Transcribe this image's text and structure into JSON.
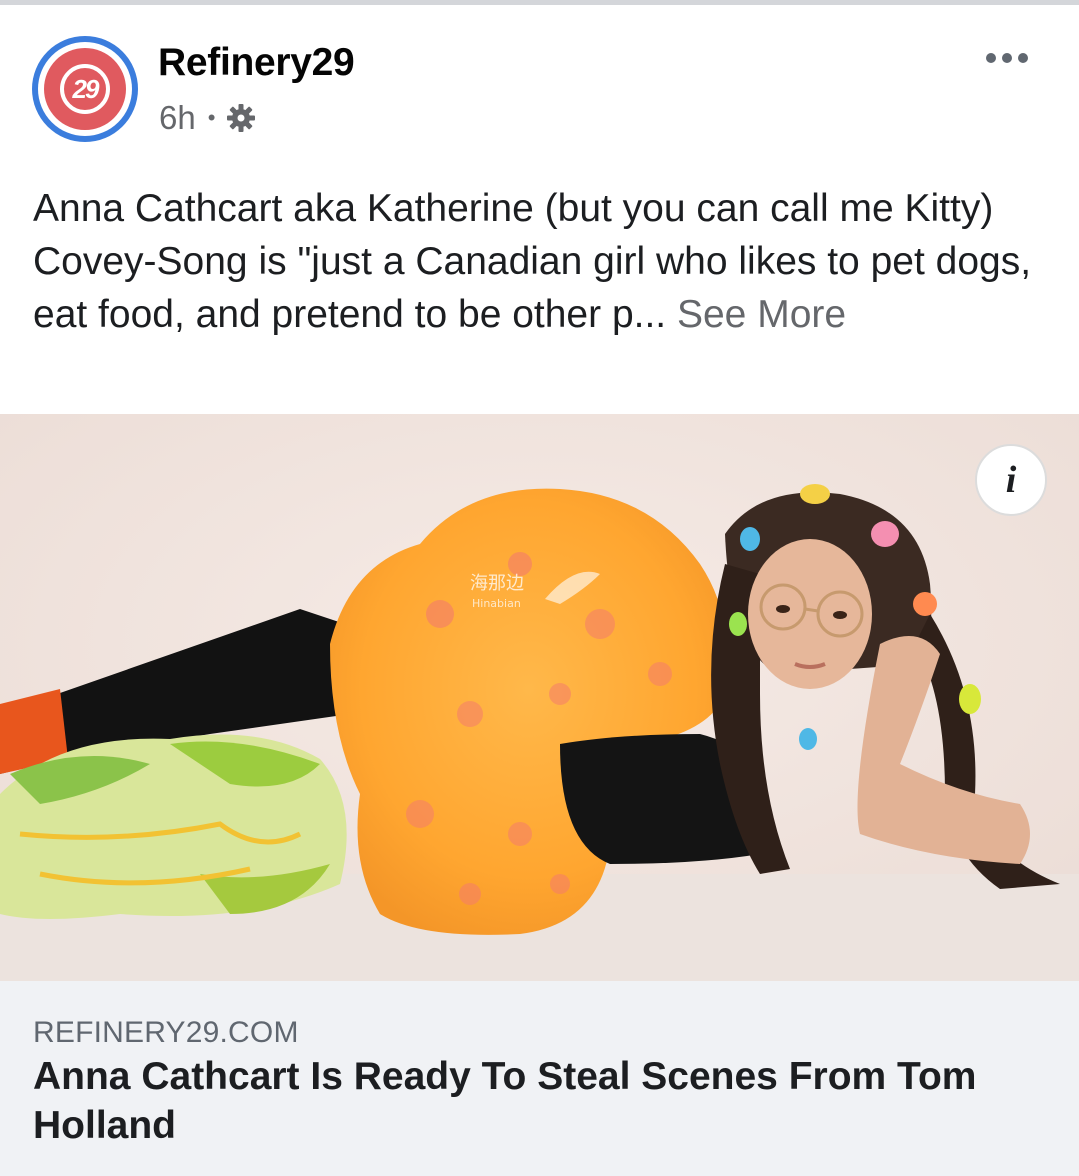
{
  "post": {
    "page_name": "Refinery29",
    "time": "6h",
    "separator": "•",
    "avatar_text": "29",
    "caption": "Anna Cathcart aka Katherine (but you can call me Kitty) Covey-Song is \"just a Canadian girl who likes to pet dogs, eat food, and pretend to be other p...",
    "see_more": "See More",
    "icons": {
      "privacy": "gear-icon",
      "menu": "more-icon",
      "info": "info-icon"
    }
  },
  "image": {
    "info_glyph": "i",
    "watermark": "海那边",
    "watermark_sub": "Hinabian"
  },
  "link": {
    "domain": "REFINERY29.COM",
    "headline": "Anna Cathcart Is Ready To Steal Scenes From Tom Holland"
  },
  "colors": {
    "brand_red": "#e05a5f",
    "brand_blue": "#3b7ddd",
    "secondary_text": "#65676b",
    "link_bg": "#f0f2f5"
  }
}
